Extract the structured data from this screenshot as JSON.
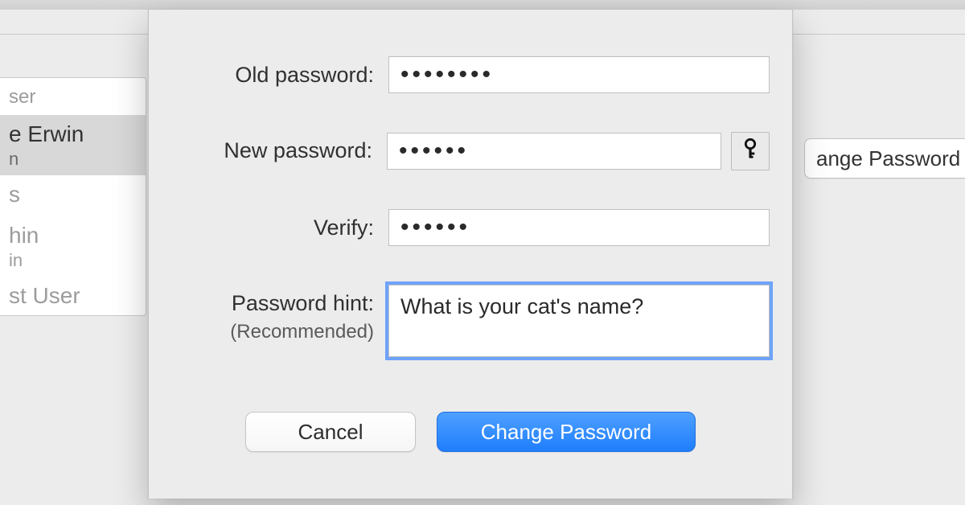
{
  "sidebar": {
    "header": "ser",
    "items": [
      {
        "name": "e Erwin",
        "sub": "n"
      },
      {
        "name": "s",
        "sub": ""
      },
      {
        "name": "hin",
        "sub": "in"
      },
      {
        "name": "st User",
        "sub": ""
      }
    ]
  },
  "background": {
    "change_button_partial": "ange Password"
  },
  "sheet": {
    "old_password": {
      "label": "Old password:",
      "value": "••••••••"
    },
    "new_password": {
      "label": "New password:",
      "value": "••••••"
    },
    "verify": {
      "label": "Verify:",
      "value": "••••••"
    },
    "hint": {
      "label": "Password hint:",
      "sublabel": "(Recommended)",
      "value": "What is your cat's name?"
    },
    "key_icon": "key-icon",
    "buttons": {
      "cancel": "Cancel",
      "change": "Change Password"
    }
  }
}
